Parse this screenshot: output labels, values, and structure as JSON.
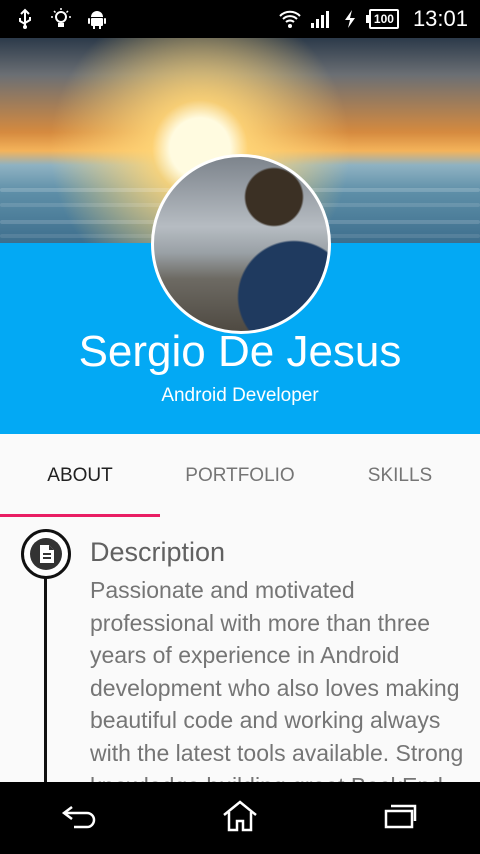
{
  "status_bar": {
    "left_icons": [
      "usb-icon",
      "lightbulb-icon",
      "android-icon"
    ],
    "right_icons": [
      "wifi-icon",
      "signal-icon",
      "charging-icon"
    ],
    "battery": "100",
    "time": "13:01"
  },
  "profile": {
    "name": "Sergio De Jesus",
    "role": "Android Developer"
  },
  "tabs": [
    {
      "label": "ABOUT",
      "active": true
    },
    {
      "label": "PORTFOLIO",
      "active": false
    },
    {
      "label": "SKILLS",
      "active": false
    }
  ],
  "about": {
    "icon": "document-icon",
    "title": "Description",
    "body": "Passionate and motivated professional with more than three years of experience in Android development who also loves making beautiful code and working always with the latest tools available. Strong knowledge building great BackEnd"
  },
  "nav_bar": {
    "icons": [
      "back-icon",
      "home-icon",
      "recents-icon"
    ]
  },
  "colors": {
    "accent": "#03a9f4",
    "tab_indicator": "#e91e63"
  }
}
